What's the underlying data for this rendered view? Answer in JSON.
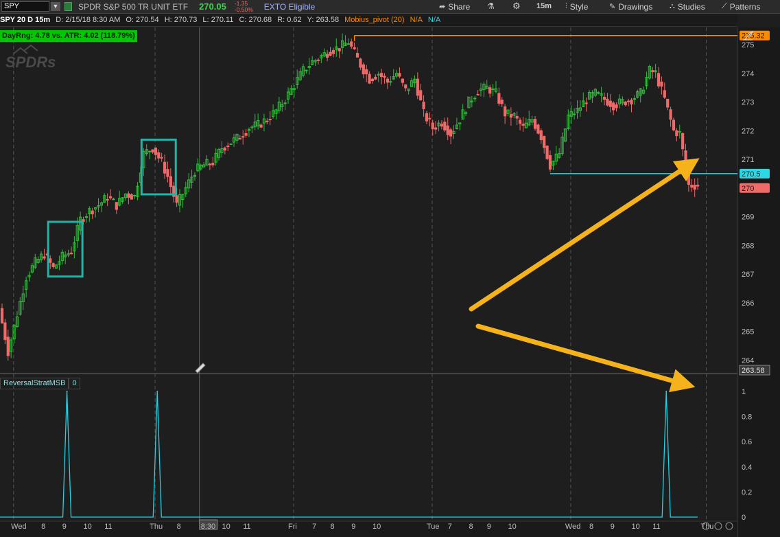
{
  "header": {
    "symbol": "SPY",
    "symbol_dropdown": "▼",
    "description": "SPDR S&P 500 TR UNIT ETF",
    "last_price": "270.05",
    "net_change": "-1.35",
    "pct_change": "-0.50%",
    "exto": "EXTO Eligible",
    "timeframe": "15m",
    "buttons": {
      "share": "Share",
      "style": "Style",
      "drawings": "Drawings",
      "studies": "Studies",
      "patterns": "Patterns"
    }
  },
  "info_bar": {
    "symbol_period": "SPY 20 D 15m",
    "date": "D: 2/15/18 8:30 AM",
    "open": "O: 270.54",
    "high": "H: 270.73",
    "low": "L: 270.11",
    "close": "C: 270.68",
    "range": "R: 0.62",
    "y_value": "Y: 263.58",
    "study": "Mobius_pivot (20)",
    "na1": "N/A",
    "na2": "N/A"
  },
  "dayrng_label": "DayRng: 4.78 vs. ATR: 4.02 (118.79%)",
  "watermark": "SPDRs",
  "lower_study": {
    "name": "ReversalStratMSB",
    "value": "0"
  },
  "colors": {
    "up": "#2fbf3a",
    "down": "#f06a6a",
    "resistance": "#ff8a00",
    "support": "#2fd6e6",
    "annotation": "#f5b21a",
    "box": "#1fb5a8",
    "indicator": "#22d3e6"
  },
  "chart_data": [
    {
      "type": "candlestick",
      "ylim": [
        263.6,
        275.6
      ],
      "y_ticks": [
        264,
        265,
        266,
        267,
        268,
        269,
        270,
        271,
        272,
        273,
        274,
        275
      ],
      "x_ticks": [
        {
          "i": 3,
          "label": "Wed"
        },
        {
          "i": 13,
          "label": "8"
        },
        {
          "i": 20,
          "label": "9"
        },
        {
          "i": 27,
          "label": "10"
        },
        {
          "i": 34,
          "label": "11"
        },
        {
          "i": 49,
          "label": "Thu"
        },
        {
          "i": 58,
          "label": "8"
        },
        {
          "i": 66,
          "label": "8:30"
        },
        {
          "i": 73,
          "label": "10"
        },
        {
          "i": 80,
          "label": "11"
        },
        {
          "i": 95,
          "label": "Fri"
        },
        {
          "i": 103,
          "label": "7"
        },
        {
          "i": 109,
          "label": "8"
        },
        {
          "i": 116,
          "label": "9"
        },
        {
          "i": 123,
          "label": "10"
        },
        {
          "i": 141,
          "label": "Tue"
        },
        {
          "i": 148,
          "label": "7"
        },
        {
          "i": 155,
          "label": "8"
        },
        {
          "i": 161,
          "label": "9"
        },
        {
          "i": 168,
          "label": "10"
        },
        {
          "i": 187,
          "label": "Wed"
        },
        {
          "i": 195,
          "label": "8"
        },
        {
          "i": 202,
          "label": "9"
        },
        {
          "i": 209,
          "label": "10"
        },
        {
          "i": 216,
          "label": "11"
        },
        {
          "i": 232,
          "label": "Thu"
        }
      ],
      "price_labels": {
        "resistance": "275.32",
        "support": "270.5",
        "last": "270",
        "crosshair": "263.58"
      },
      "resistance": 275.32,
      "support": 270.5,
      "waypoints": [
        [
          0,
          265.8
        ],
        [
          3,
          264.3
        ],
        [
          6,
          265.6
        ],
        [
          9,
          266.9
        ],
        [
          12,
          267.4
        ],
        [
          15,
          267.7
        ],
        [
          18,
          267.2
        ],
        [
          21,
          267.6
        ],
        [
          24,
          267.8
        ],
        [
          27,
          268.9
        ],
        [
          30,
          269.2
        ],
        [
          33,
          269.4
        ],
        [
          36,
          269.7
        ],
        [
          39,
          269.4
        ],
        [
          42,
          269.8
        ],
        [
          45,
          269.7
        ],
        [
          48,
          271.2
        ],
        [
          51,
          271.4
        ],
        [
          54,
          270.9
        ],
        [
          56,
          270.4
        ],
        [
          59,
          269.4
        ],
        [
          62,
          270.0
        ],
        [
          65,
          270.6
        ],
        [
          68,
          270.8
        ],
        [
          71,
          270.9
        ],
        [
          74,
          271.4
        ],
        [
          77,
          271.6
        ],
        [
          80,
          271.8
        ],
        [
          83,
          272.1
        ],
        [
          86,
          272.2
        ],
        [
          89,
          272.4
        ],
        [
          92,
          272.7
        ],
        [
          95,
          273.1
        ],
        [
          98,
          273.6
        ],
        [
          101,
          274.1
        ],
        [
          104,
          274.4
        ],
        [
          107,
          274.6
        ],
        [
          110,
          274.8
        ],
        [
          113,
          274.9
        ],
        [
          116,
          275.1
        ],
        [
          118,
          274.7
        ],
        [
          120,
          274.3
        ],
        [
          123,
          273.8
        ],
        [
          126,
          274.0
        ],
        [
          129,
          273.7
        ],
        [
          132,
          274.0
        ],
        [
          135,
          273.4
        ],
        [
          138,
          273.8
        ],
        [
          141,
          272.6
        ],
        [
          144,
          272.1
        ],
        [
          147,
          272.3
        ],
        [
          150,
          271.9
        ],
        [
          153,
          272.4
        ],
        [
          156,
          273.0
        ],
        [
          159,
          273.4
        ],
        [
          162,
          273.5
        ],
        [
          165,
          273.3
        ],
        [
          168,
          272.6
        ],
        [
          171,
          272.5
        ],
        [
          174,
          272.1
        ],
        [
          177,
          272.4
        ],
        [
          180,
          271.8
        ],
        [
          183,
          270.8
        ],
        [
          186,
          271.2
        ],
        [
          189,
          272.5
        ],
        [
          192,
          272.7
        ],
        [
          195,
          273.1
        ],
        [
          198,
          273.3
        ],
        [
          201,
          273.1
        ],
        [
          204,
          272.9
        ],
        [
          207,
          273.0
        ],
        [
          210,
          273.1
        ],
        [
          213,
          273.3
        ],
        [
          216,
          274.1
        ],
        [
          218,
          274.0
        ],
        [
          221,
          273.1
        ],
        [
          224,
          272.0
        ],
        [
          226,
          271.9
        ],
        [
          229,
          270.1
        ]
      ],
      "reversal_boxes": [
        {
          "start": 16,
          "end": 26
        },
        {
          "start": 47,
          "end": 57
        }
      ],
      "annotations": [
        {
          "type": "arrow",
          "from": [
            687,
            450
          ],
          "to": [
            1008,
            238
          ]
        },
        {
          "type": "arrow",
          "from": [
            697,
            475
          ],
          "to": [
            1000,
            560
          ]
        }
      ]
    },
    {
      "type": "line",
      "name": "ReversalStratMSB",
      "ylim": [
        0,
        1
      ],
      "y_ticks": [
        0,
        0.2,
        0.4,
        0.6,
        0.8,
        1
      ],
      "spikes": [
        22,
        52,
        221
      ]
    }
  ]
}
